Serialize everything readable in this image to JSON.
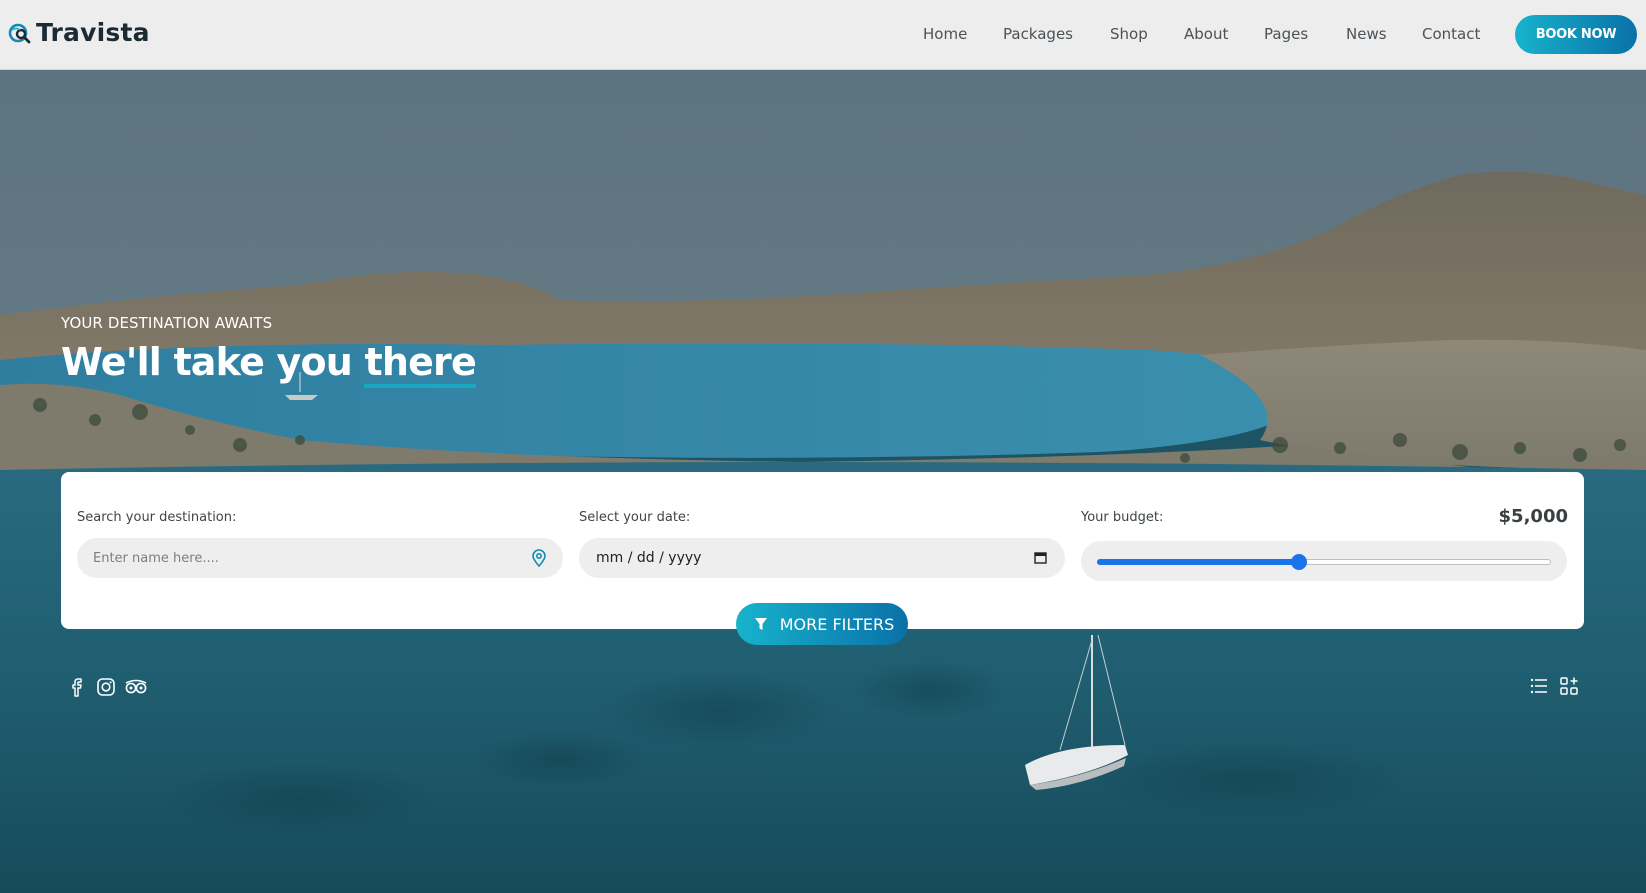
{
  "header": {
    "brand": "Travista",
    "nav": [
      "Home",
      "Packages",
      "Shop",
      "About",
      "Pages",
      "News",
      "Contact"
    ],
    "cta": "BOOK NOW"
  },
  "hero": {
    "eyebrow": "YOUR DESTINATION AWAITS",
    "headline_start": "We'll take you ",
    "headline_highlight": "there"
  },
  "search": {
    "destination": {
      "label": "Search your destination:",
      "placeholder": "Enter name here...."
    },
    "date": {
      "label": "Select your date:",
      "value": "mm / dd / yyyy"
    },
    "budget": {
      "label": "Your budget:",
      "value": "$5,000",
      "slider_fraction": 0.445
    },
    "more_filters": "MORE FILTERS"
  },
  "icons": {
    "social": [
      "facebook-icon",
      "instagram-icon",
      "tripadvisor-icon"
    ],
    "view_toggles": [
      "list-view-icon",
      "grid-view-icon"
    ]
  },
  "colors": {
    "accent_start": "#17b3cc",
    "accent_end": "#0a71a8",
    "slider": "#1a73e8",
    "brand_text": "#1c2a33"
  }
}
